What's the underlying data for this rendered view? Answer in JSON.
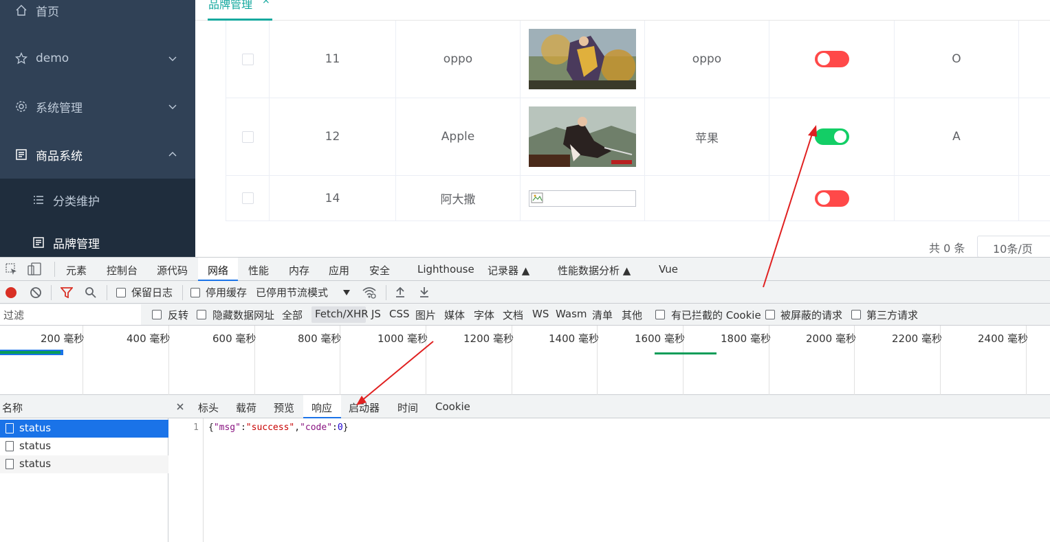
{
  "sidebar": {
    "items": [
      {
        "label": "首页",
        "icon": "home-icon"
      },
      {
        "label": "demo",
        "icon": "star-icon"
      },
      {
        "label": "系统管理",
        "icon": "gear-icon"
      },
      {
        "label": "商品系统",
        "icon": "document-icon"
      }
    ],
    "subitems": [
      {
        "label": "分类维护",
        "icon": "list-icon"
      },
      {
        "label": "品牌管理",
        "icon": "document-icon"
      }
    ]
  },
  "tabs": {
    "active_label": "品牌管理",
    "close": "×"
  },
  "table": {
    "rows": [
      {
        "id": "11",
        "name": "oppo",
        "description": "oppo",
        "enabled": false,
        "first_letter": "O",
        "has_image": true
      },
      {
        "id": "12",
        "name": "Apple",
        "description": "苹果",
        "enabled": true,
        "first_letter": "A",
        "has_image": true
      },
      {
        "id": "14",
        "name": "阿大撒",
        "description": "",
        "enabled": false,
        "first_letter": "",
        "has_image": false
      }
    ]
  },
  "pagination": {
    "total_text": "共 0 条",
    "page_size": "10条/页"
  },
  "devtools": {
    "tabs": [
      "元素",
      "控制台",
      "源代码",
      "网络",
      "性能",
      "内存",
      "应用",
      "安全",
      "Lighthouse",
      "记录器 ▲",
      "性能数据分析 ▲",
      "Vue"
    ],
    "active_tab": "网络",
    "toolbar": {
      "preserve_log": "保留日志",
      "disable_cache": "停用缓存",
      "throttle": "已停用节流模式"
    },
    "filter": {
      "placeholder": "过滤",
      "invert": "反转",
      "hide_data_urls": "隐藏数据网址",
      "types": [
        "全部",
        "Fetch/XHR",
        "JS",
        "CSS",
        "图片",
        "媒体",
        "字体",
        "文档",
        "WS",
        "Wasm",
        "清单",
        "其他"
      ],
      "active_type": "Fetch/XHR",
      "blocked_cookies": "有已拦截的 Cookie",
      "blocked_requests": "被屏蔽的请求",
      "third_party": "第三方请求"
    },
    "timeline_labels": [
      "200 毫秒",
      "400 毫秒",
      "600 毫秒",
      "800 毫秒",
      "1000 毫秒",
      "1200 毫秒",
      "1400 毫秒",
      "1600 毫秒",
      "1800 毫秒",
      "2000 毫秒",
      "2200 毫秒",
      "2400 毫秒"
    ],
    "request_list": {
      "header": "名称",
      "rows": [
        "status",
        "status",
        "status"
      ]
    },
    "detail_tabs": [
      "标头",
      "载荷",
      "预览",
      "响应",
      "启动器",
      "时间",
      "Cookie"
    ],
    "active_detail_tab": "响应",
    "response": {
      "line_number": "1",
      "open_brace": "{",
      "key1": "\"msg\"",
      "val1": "\"success\"",
      "key2": "\"code\"",
      "val2": "0",
      "close_brace": "}"
    }
  },
  "colors": {
    "sidebar_bg": "#304156",
    "accent": "#13a89e",
    "switch_on": "#13ce66",
    "switch_off": "#ff4949",
    "annotation_arrow": "#e02020",
    "devtools_blue": "#1a73e8"
  }
}
